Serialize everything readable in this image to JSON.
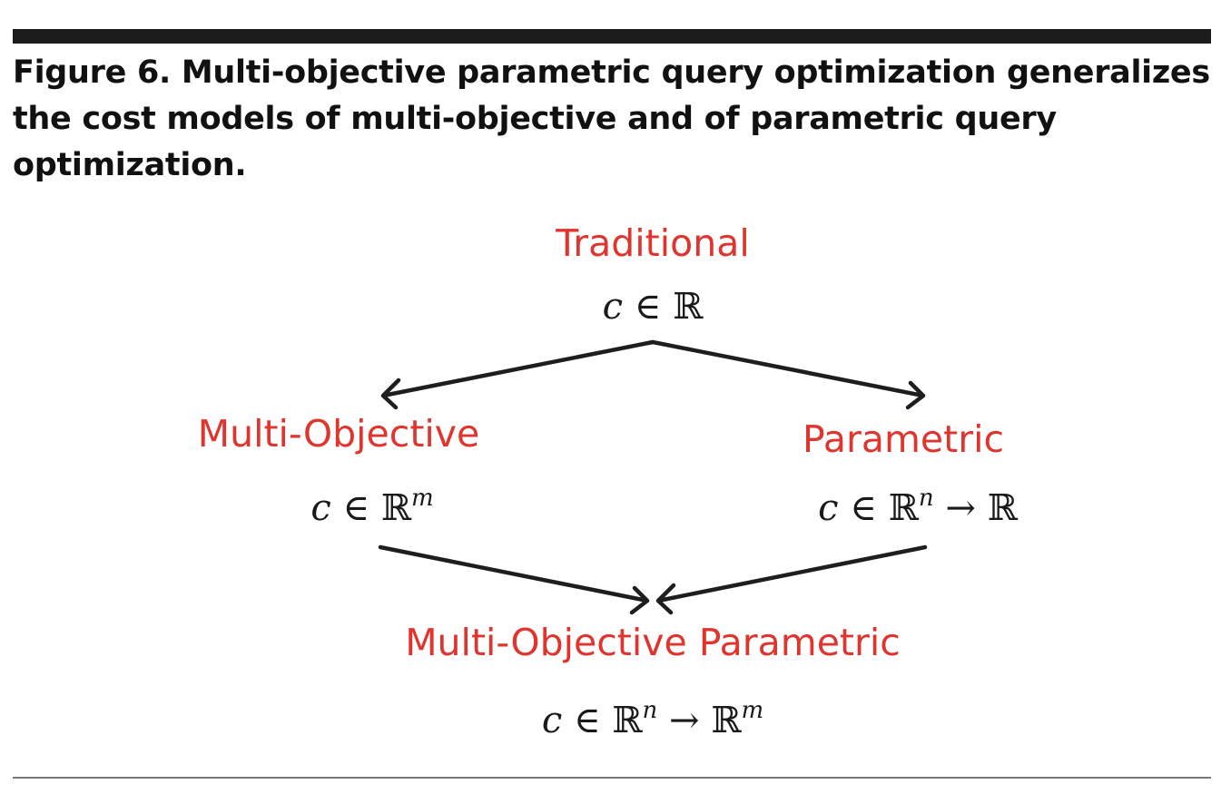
{
  "figure": {
    "caption": "Figure 6. Multi-objective parametric query optimization generalizes the cost models of multi-objective and of parametric query optimization."
  },
  "nodes": {
    "traditional": {
      "title": "Traditional",
      "formula": {
        "var": "c",
        "rel": "∈",
        "set": "ℝ"
      }
    },
    "multi_objective": {
      "title": "Multi-Objective",
      "formula": {
        "var": "c",
        "rel": "∈",
        "set": "ℝ",
        "exp": "m"
      }
    },
    "parametric": {
      "title": "Parametric",
      "formula": {
        "var": "c",
        "rel": "∈",
        "set": "ℝ",
        "exp": "n",
        "arrow": "→",
        "target": "ℝ"
      }
    },
    "mo_parametric": {
      "title": "Multi-Objective Parametric",
      "formula": {
        "var": "c",
        "rel": "∈",
        "set": "ℝ",
        "exp": "n",
        "arrow": "→",
        "target": "ℝ",
        "target_exp": "m"
      }
    }
  },
  "colors": {
    "node_title": "#e0352f",
    "formula": "#1a1a1a",
    "arrow": "#1e1e1e",
    "caption": "#111111"
  }
}
